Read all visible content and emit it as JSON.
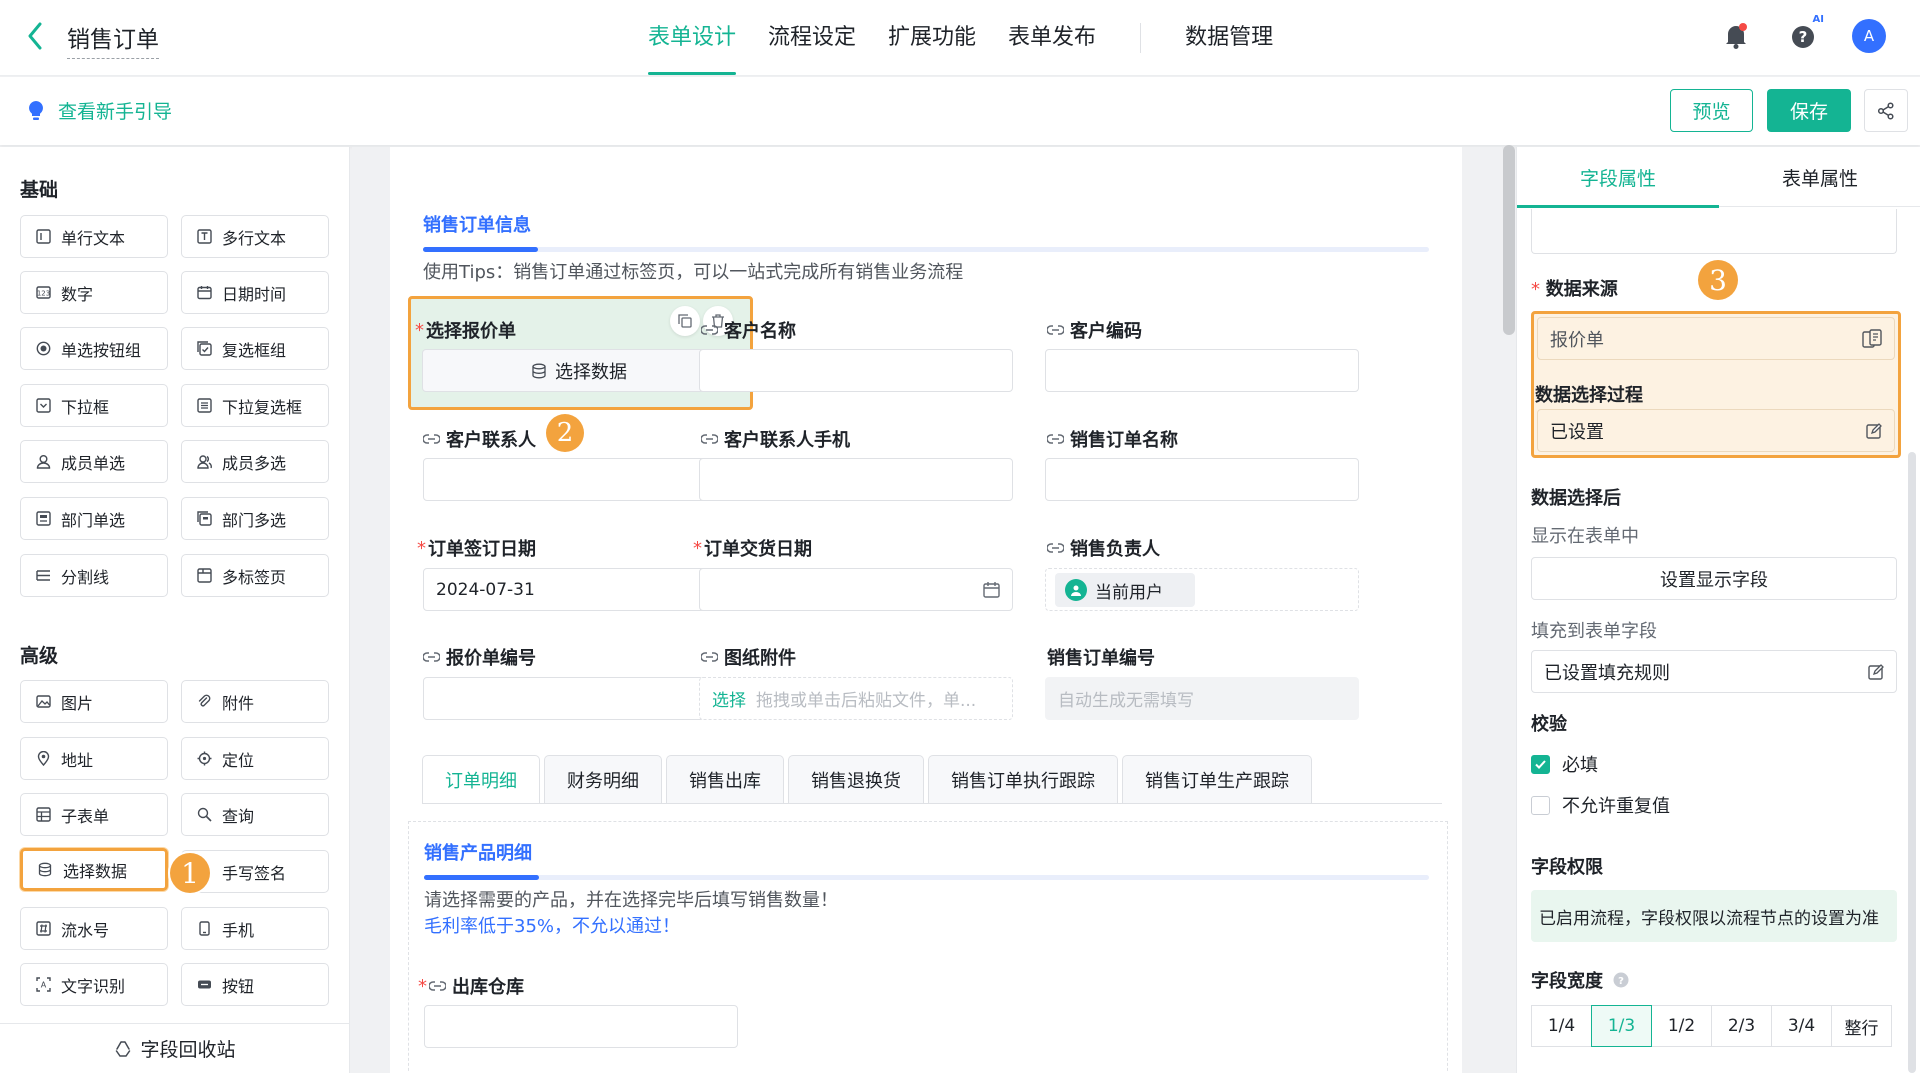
{
  "header": {
    "title": "销售订单",
    "tabs": [
      {
        "label": "表单设计",
        "active": true
      },
      {
        "label": "流程设定"
      },
      {
        "label": "扩展功能"
      },
      {
        "label": "表单发布"
      }
    ],
    "data_tab": "数据管理",
    "icons": [
      "bell-icon",
      "help-icon",
      "ai-icon"
    ],
    "ai_label": "AI",
    "avatar": "A"
  },
  "toolbar": {
    "guide_label": "查看新手引导",
    "preview_label": "预览",
    "save_label": "保存"
  },
  "left_panel": {
    "basic_title": "基础",
    "basic_items": [
      "单行文本",
      "多行文本",
      "数字",
      "日期时间",
      "单选按钮组",
      "复选框组",
      "下拉框",
      "下拉复选框",
      "成员单选",
      "成员多选",
      "部门单选",
      "部门多选",
      "分割线",
      "多标签页"
    ],
    "advanced_title": "高级",
    "advanced_items": [
      "图片",
      "附件",
      "地址",
      "定位",
      "子表单",
      "查询",
      "选择数据",
      "手写签名",
      "流水号",
      "手机",
      "文字识别",
      "按钮"
    ],
    "recycle_label": "字段回收站",
    "badge": "1"
  },
  "form": {
    "section_title": "销售订单信息",
    "tips": "使用Tips：销售订单通过标签页，可以一站式完成所有销售业务流程",
    "fields": {
      "quote": {
        "label": "选择报价单",
        "button": "选择数据"
      },
      "customer_name": {
        "label": "客户名称"
      },
      "customer_code": {
        "label": "客户编码"
      },
      "contact": {
        "label": "客户联系人",
        "badge": "2"
      },
      "contact_phone": {
        "label": "客户联系人手机"
      },
      "order_name": {
        "label": "销售订单名称"
      },
      "sign_date": {
        "label": "订单签订日期",
        "value": "2024-07-31"
      },
      "delivery_date": {
        "label": "订单交货日期",
        "value": ""
      },
      "owner": {
        "label": "销售负责人",
        "value": "当前用户"
      },
      "quote_no": {
        "label": "报价单编号"
      },
      "attachment": {
        "label": "图纸附件",
        "link": "选择",
        "placeholder": "拖拽或单击后粘贴文件，单..."
      },
      "order_no": {
        "label": "销售订单编号",
        "placeholder": "自动生成无需填写"
      }
    },
    "subtabs": [
      "订单明细",
      "财务明细",
      "销售出库",
      "销售退换货",
      "销售订单执行跟踪",
      "销售订单生产跟踪"
    ],
    "sub_section_title": "销售产品明细",
    "sub_tip1": "请选择需要的产品，并在选择完毕后填写销售数量！",
    "sub_tip2": "毛利率低于35%，不允以通过！",
    "warehouse_label": "出库仓库"
  },
  "right_panel": {
    "tabs": [
      "字段属性",
      "表单属性"
    ],
    "data_source_label": "数据来源",
    "data_source_value": "报价单",
    "badge": "3",
    "selection_process_label": "数据选择过程",
    "selection_process_value": "已设置",
    "after_select_label": "数据选择后",
    "show_in_form_label": "显示在表单中",
    "set_display_fields": "设置显示字段",
    "fill_label": "填充到表单字段",
    "fill_value": "已设置填充规则",
    "validation_label": "校验",
    "required_label": "必填",
    "required_checked": true,
    "no_dup_label": "不允许重复值",
    "no_dup_checked": false,
    "permission_label": "字段权限",
    "permission_note": "已启用流程，字段权限以流程节点的设置为准",
    "width_label": "字段宽度",
    "widths": [
      "1/4",
      "1/3",
      "1/2",
      "2/3",
      "3/4",
      "整行"
    ],
    "width_selected": "1/3"
  },
  "colors": {
    "primary": "#14b493",
    "accent_blue": "#3370ff",
    "highlight": "#f3a33e",
    "required": "#f54a45"
  }
}
